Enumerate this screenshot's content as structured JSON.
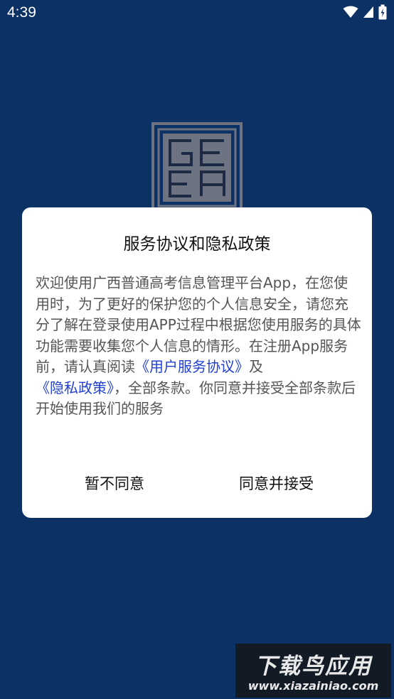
{
  "status_bar": {
    "time": "4:39",
    "icons": [
      "wifi-icon",
      "signal-icon",
      "battery-icon"
    ]
  },
  "splash": {
    "logo_icon": "geea-logo",
    "logo_text": "GEEA"
  },
  "dialog": {
    "title": "服务协议和隐私政策",
    "body_text_1": "欢迎使用广西普通高考信息管理平台App，在您使用时，为了更好的保护您的个人信息安全，请您充分了解在登录使用APP过程中根据您使用服务的具体功能需要收集您个人信息的情形。在注册App服务前，请认真阅读",
    "user_agreement_link": "《用户服务协议》",
    "body_text_2": "及",
    "privacy_policy_link": "《隐私政策》",
    "body_text_3": "，全部条款。你同意并接受全部条款后开始使用我们的服务",
    "decline_label": "暂不同意",
    "accept_label": "同意并接受"
  },
  "watermark": {
    "title": "下载鸟应用",
    "url": "www.xiazainiao.com"
  },
  "colors": {
    "background": "#0c3164",
    "link": "#1f3fd6",
    "dialog_bg": "#ffffff"
  }
}
